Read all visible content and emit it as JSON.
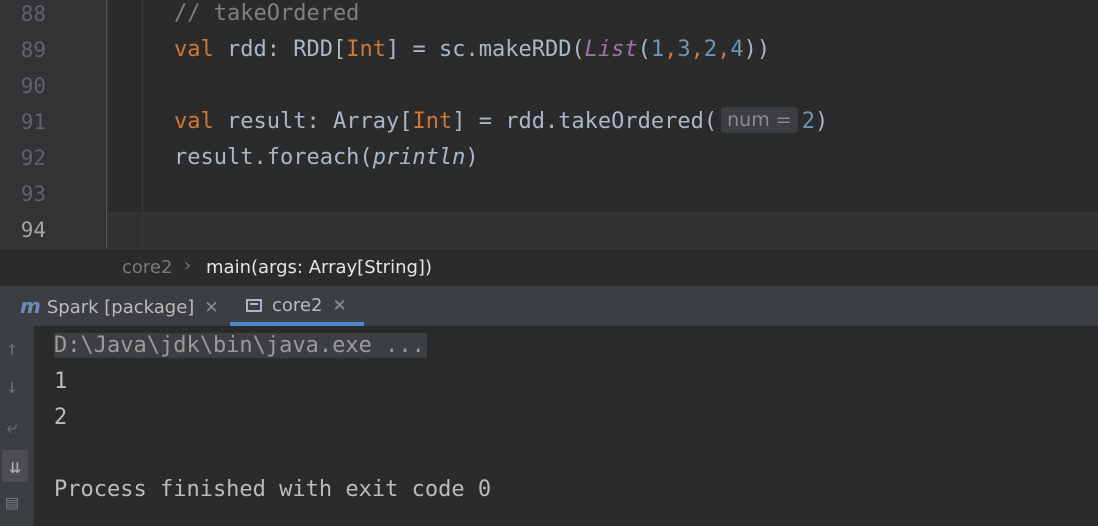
{
  "editor": {
    "lines": [
      {
        "number": "88",
        "comment": "// takeOrdered"
      },
      {
        "number": "89",
        "kw": "val",
        "name": "rdd",
        "colon": ": ",
        "type_outer": "RDD",
        "type_inner": "Int",
        "assign": " = sc.makeRDD(",
        "list_fn": "List",
        "args": [
          "1",
          "3",
          "2",
          "4"
        ],
        "close": "))"
      },
      {
        "number": "90"
      },
      {
        "number": "91",
        "kw": "val",
        "name": "result",
        "colon": ": ",
        "type_outer": "Array",
        "type_inner": "Int",
        "assign": " = rdd.takeOrdered(",
        "hint": "num =",
        "arg": "2",
        "close": ")"
      },
      {
        "number": "92",
        "prefix": "result.foreach(",
        "fn": "println",
        "close": ")"
      },
      {
        "number": "93"
      },
      {
        "number": "94"
      }
    ]
  },
  "breadcrumb": {
    "items": [
      "core2",
      "main(args: Array[String])"
    ]
  },
  "run_tabs": [
    {
      "label": "Spark [package]",
      "icon": "maven-icon"
    },
    {
      "label": "core2",
      "icon": "console-icon"
    }
  ],
  "console": {
    "command": "D:\\Java\\jdk\\bin\\java.exe ...",
    "output": [
      "1",
      "2"
    ],
    "finish": "Process finished with exit code 0"
  },
  "colors": {
    "keyword": "#cc7832",
    "number": "#6897bb",
    "comment": "#808080",
    "italic_object": "#9876aa",
    "accent": "#4a88c7"
  }
}
